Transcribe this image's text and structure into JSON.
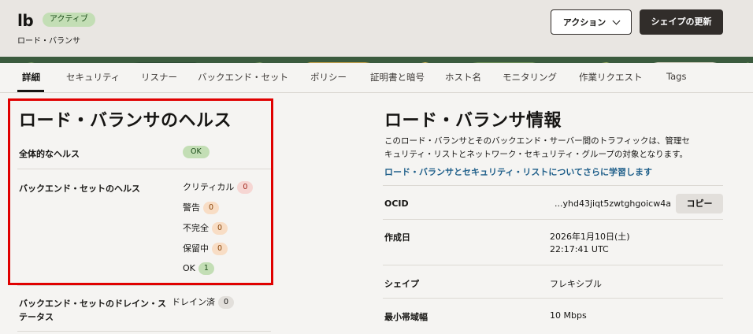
{
  "header": {
    "resource_name": "lb",
    "status": "アクティブ",
    "resource_type": "ロード・バランサ",
    "actions_label": "アクション",
    "update_shape_label": "シェイプの更新",
    "status_color": "#c3deb5"
  },
  "tabs": [
    {
      "label": "詳細",
      "active": true
    },
    {
      "label": "セキュリティ"
    },
    {
      "label": "リスナー"
    },
    {
      "label": "バックエンド・セット"
    },
    {
      "label": "ポリシー"
    },
    {
      "label": "証明書と暗号"
    },
    {
      "label": "ホスト名"
    },
    {
      "label": "モニタリング"
    },
    {
      "label": "作業リクエスト"
    },
    {
      "label": "Tags"
    }
  ],
  "health": {
    "title": "ロード・バランサのヘルス",
    "overall_label": "全体的なヘルス",
    "overall_value": "OK",
    "backend_label": "バックエンド・セットのヘルス",
    "backend_statuses": [
      {
        "label": "クリティカル",
        "count": "0",
        "color": "#f6d6d3"
      },
      {
        "label": "警告",
        "count": "0",
        "color": "#f8ddc5"
      },
      {
        "label": "不完全",
        "count": "0",
        "color": "#f8ddc5"
      },
      {
        "label": "保留中",
        "count": "0",
        "color": "#f8ddc5"
      },
      {
        "label": "OK",
        "count": "1",
        "color": "#c3deb5"
      }
    ],
    "drain_label": "バックエンド・セットのドレイン・ステータス",
    "drain_label_line1": "バックエンド・セットのドレイン・ス",
    "drain_label_line2": "テータス",
    "drain_value": "ドレイン済",
    "drain_count": "0"
  },
  "info": {
    "title": "ロード・バランサ情報",
    "description_line1": "このロード・バランサとそのバックエンド・サーバー間のトラフィックは、管理セ",
    "description_line2": "キュリティ・リストとネットワーク・セキュリティ・グループの対象となります。",
    "learn_more": "ロード・バランサとセキュリティ・リストについてさらに学習します",
    "ocid_label": "OCID",
    "ocid_value": "...yhd43jiqt5zwtghgoicw4a",
    "copy_label": "コピー",
    "created_label": "作成日",
    "created_date": "2026年1月10日(土)",
    "created_time": "22:17:41 UTC",
    "shape_label": "シェイプ",
    "shape_value": "フレキシブル",
    "bandwidth_label": "最小帯域幅",
    "bandwidth_value": "10 Mbps"
  }
}
